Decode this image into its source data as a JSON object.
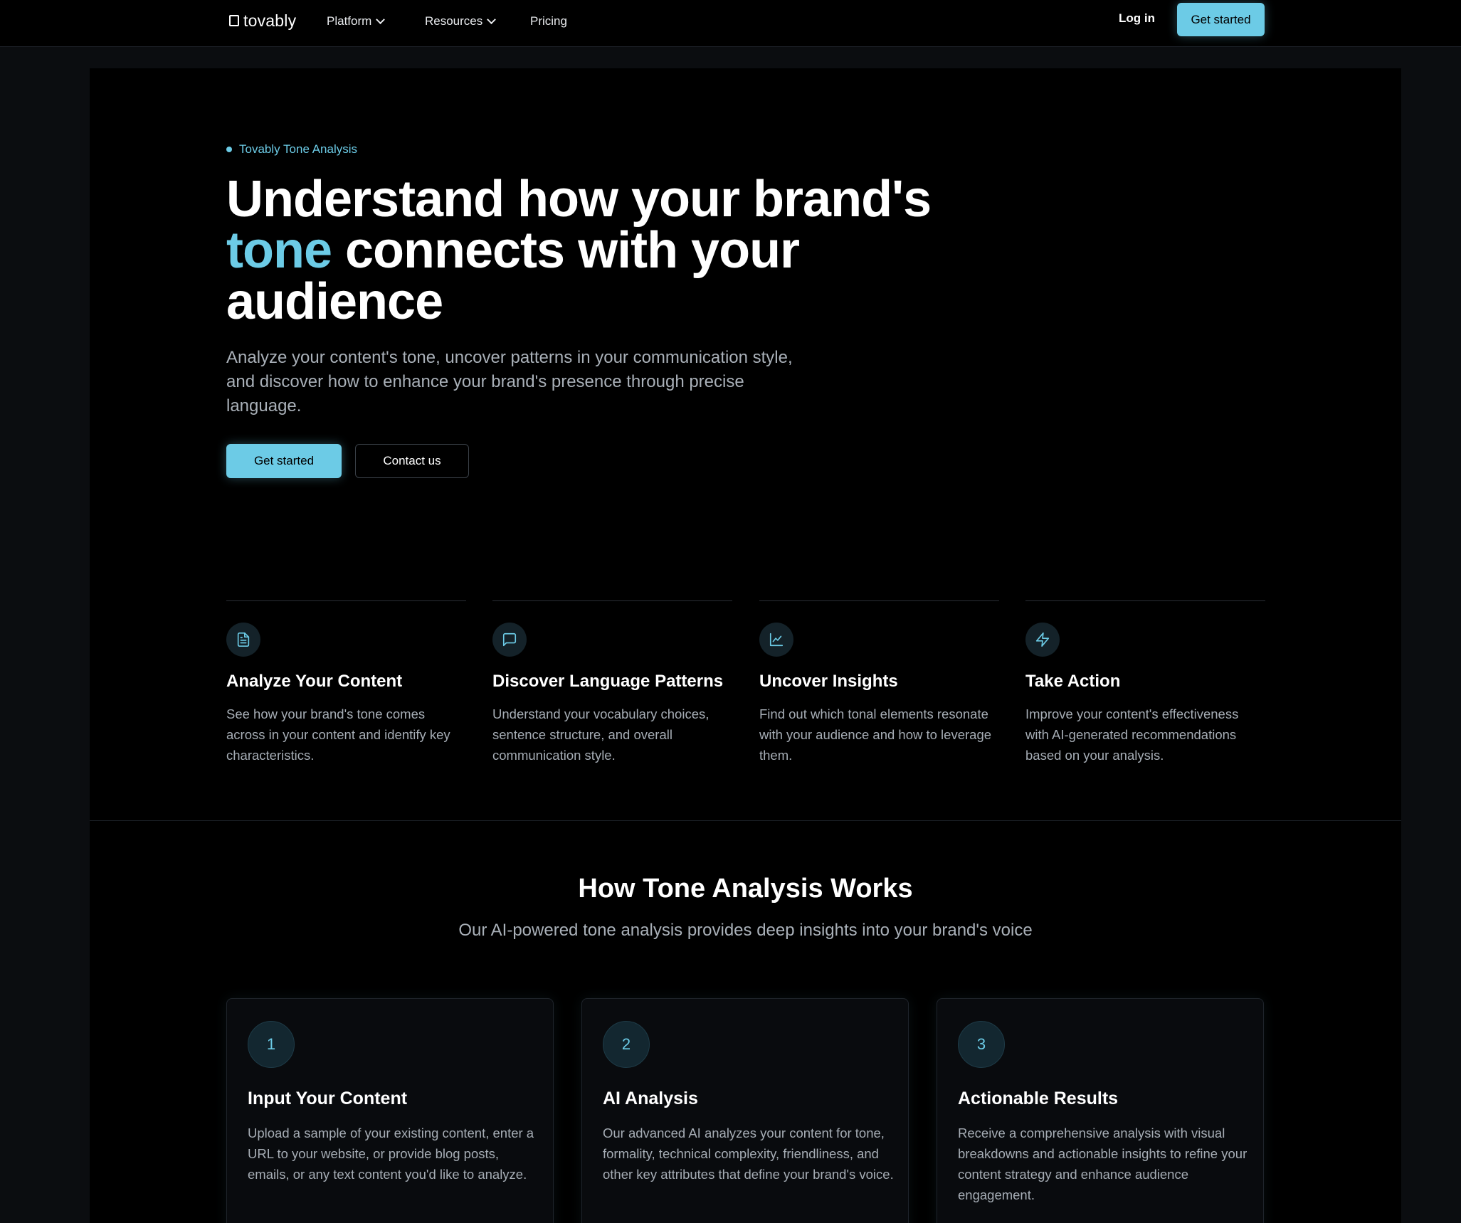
{
  "nav": {
    "logo": "tovably",
    "items": [
      {
        "label": "Platform",
        "has_dropdown": true
      },
      {
        "label": "Resources",
        "has_dropdown": true
      },
      {
        "label": "Pricing",
        "has_dropdown": false
      }
    ],
    "login": "Log in",
    "cta": "Get started"
  },
  "hero": {
    "eyebrow": "Tovably Tone Analysis",
    "title_line1": "Understand how your brand's",
    "title_accent": "tone",
    "title_line2_rest": " connects with your",
    "title_line3": "audience",
    "subtitle": "Analyze your content's tone, uncover patterns in your communication style, and discover how to enhance your brand's presence through precise language.",
    "primary_button": "Get started",
    "secondary_button": "Contact us"
  },
  "features": [
    {
      "icon": "document-icon",
      "title": "Analyze Your Content",
      "text": "See how your brand's tone comes across in your content and identify key characteristics."
    },
    {
      "icon": "chat-bubble-icon",
      "title": "Discover Language Patterns",
      "text": "Understand your vocabulary choices, sentence structure, and overall communication style."
    },
    {
      "icon": "line-chart-icon",
      "title": "Uncover Insights",
      "text": "Find out which tonal elements resonate with your audience and how to leverage them."
    },
    {
      "icon": "lightning-icon",
      "title": "Take Action",
      "text": "Improve your content's effectiveness with AI-generated recommendations based on your analysis."
    }
  ],
  "how": {
    "title": "How Tone Analysis Works",
    "subtitle": "Our AI-powered tone analysis provides deep insights into your brand's voice",
    "steps": [
      {
        "number": "1",
        "title": "Input Your Content",
        "text": "Upload a sample of your existing content, enter a URL to your website, or provide blog posts, emails, or any text content you'd like to analyze."
      },
      {
        "number": "2",
        "title": "AI Analysis",
        "text": "Our advanced AI analyzes your content for tone, formality, technical complexity, friendliness, and other key attributes that define your brand's voice."
      },
      {
        "number": "3",
        "title": "Actionable Results",
        "text": "Receive a comprehensive analysis with visual breakdowns and actionable insights to refine your content strategy and enhance audience engagement."
      }
    ]
  },
  "colors": {
    "accent": "#6ccbe6",
    "background": "#000000",
    "page": "#0b0d10",
    "muted_text": "#a6adb5"
  }
}
